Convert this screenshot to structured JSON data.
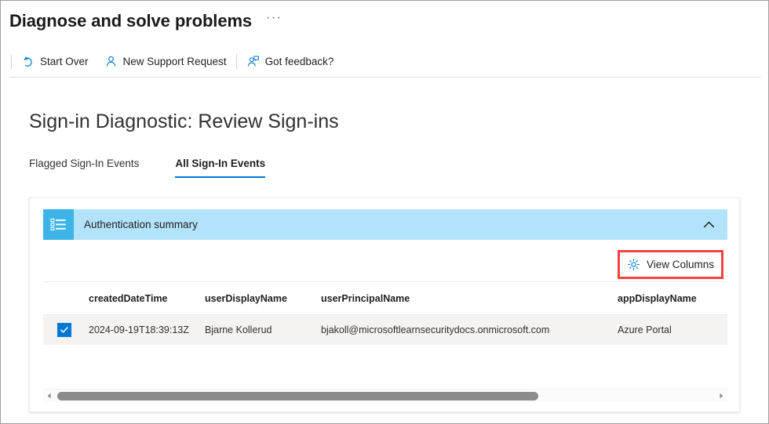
{
  "blade": {
    "title": "Diagnose and solve problems",
    "ellipsis": "···"
  },
  "commandbar": {
    "buttons": [
      {
        "label": "Start Over",
        "icon": "restart-icon"
      },
      {
        "label": "New Support Request",
        "icon": "person-add-icon"
      },
      {
        "label": "Got feedback?",
        "icon": "feedback-person-icon"
      }
    ]
  },
  "page": {
    "title": "Sign-in Diagnostic: Review Sign-ins"
  },
  "tabs": [
    {
      "label": "Flagged Sign-In Events",
      "active": false
    },
    {
      "label": "All Sign-In Events",
      "active": true
    }
  ],
  "summary": {
    "label": "Authentication summary",
    "icon": "list-summary-icon",
    "collapse_icon": "chevron-up-icon",
    "bar_color": "#b3e3fa",
    "icon_box_color": "#3cb4e8"
  },
  "toolbar": {
    "view_columns_label": "View Columns",
    "view_columns_icon": "gear-icon",
    "highlight_color": "#f5413f"
  },
  "table": {
    "columns": [
      "createdDateTime",
      "userDisplayName",
      "userPrincipalName",
      "appDisplayName"
    ],
    "rows": [
      {
        "selected": true,
        "createdDateTime": "2024-09-19T18:39:13Z",
        "userDisplayName": "Bjarne Kollerud",
        "userPrincipalName": "bjakoll@microsoftlearnsecuritydocs.onmicrosoft.com",
        "appDisplayName": "Azure Portal"
      }
    ]
  },
  "scrollbar": {
    "left_arrow_icon": "triangle-left-icon",
    "right_arrow_icon": "triangle-right-icon"
  },
  "colors": {
    "accent": "#0078d4",
    "highlight": "#f5413f",
    "summary_bar": "#b3e3fa"
  }
}
